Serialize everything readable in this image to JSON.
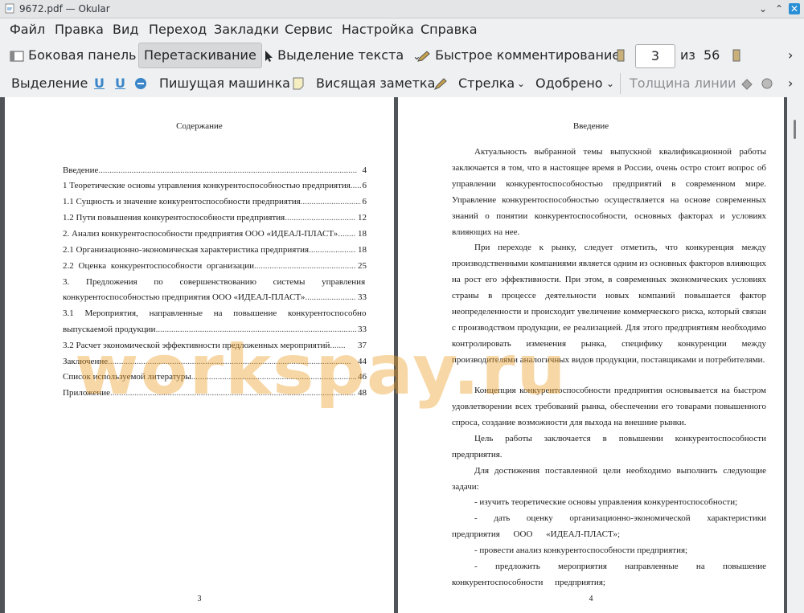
{
  "window": {
    "title": "9672.pdf  — Okular",
    "min": "⌄",
    "max": "⌃",
    "close": "✕"
  },
  "menu": [
    "Файл",
    "Правка",
    "Вид",
    "Переход",
    "Закладки",
    "Сервис",
    "Настройка",
    "Справка"
  ],
  "toolbar1": {
    "sidebar": "Боковая панель",
    "browse": "Перетаскивание",
    "text_select": "Выделение текста",
    "quick_annot": "Быстрое комментирование",
    "page_current": "3",
    "page_of": "из",
    "page_total": "56",
    "more": "›"
  },
  "toolbar2": {
    "highlight": "Выделение",
    "underline1": "U",
    "underline2": "U",
    "typewriter": "Пишущая машинка",
    "popup_note": "Висящая заметка",
    "arrow": "Стрелка",
    "stamp": "Одобрено",
    "line_width": "Толщина линии",
    "more": "›"
  },
  "page3": {
    "title": "Содержание",
    "toc": [
      {
        "text": "Введение",
        "page": "4"
      },
      {
        "text": "1 Теоретические основы управления конкурентоспособностью предприятия",
        "page": "6"
      },
      {
        "text": "1.1 Сущность и значение конкурентоспособности предприятия",
        "page": "6"
      },
      {
        "text": "1.2 Пути повышения конкурентоспособности предприятия",
        "page": "12"
      },
      {
        "text": "2. Анализ конкурентоспособности предприятия ООО «ИДЕАЛ-ПЛАСТ»",
        "page": "18"
      },
      {
        "text": "2.1 Организационно-экономическая характеристика предприятия",
        "page": "18"
      },
      {
        "text": "2.2 Оценка конкурентоспособности организации",
        "page": "25"
      },
      {
        "text": "3. Предложения по совершенствованию системы управления",
        "page": ""
      },
      {
        "text": "конкурентоспособностью предприятия ООО «ИДЕАЛ-ПЛАСТ»",
        "page": "33"
      },
      {
        "text": "3.1 Мероприятия, направленные на повышение конкурентоспособности",
        "page": ""
      },
      {
        "text": "выпускаемой продукции",
        "page": "33"
      },
      {
        "text": "3.2 Расчет экономической эффективности предложенных мероприятий",
        "page": "37"
      },
      {
        "text": "Заключение",
        "page": "44"
      },
      {
        "text": "Список используемой литературы",
        "page": "46"
      },
      {
        "text": "Приложение",
        "page": "48"
      }
    ],
    "footer": "3"
  },
  "page4": {
    "title": "Введение",
    "p1": "Актуальность выбранной темы выпускной квалификационной работы заключается в том, что в настоящее время в России, очень остро стоит вопрос об управлении конкурентоспособностью предприятий в современном мире. Управление конкурентоспособностью осуществляется на основе современных знаний о понятии конкурентоспособности, основных факторах и условиях влияющих на нее.",
    "p2": "При переходе к рынку, следует отметить, что конкуренция между производственными компаниями является одним из основных факторов влияющих на рост его эффективности. При этом, в современных экономических условиях страны в процессе деятельности новых компаний повышается фактор неопределенности и происходит увеличение коммерческого риска, который связан с производством продукции, ее реализацией. Для этого предприятиям необходимо контролировать изменения рынка, специфику конкуренции между производителями аналогичных видов продукции, поставщиками и потребителями.",
    "p3": "Концепция конкурентоспособности предприятия основывается на быстром удовлетворении всех требований рынка, обеспечении его товарами повышенного спроса, создание возможности для выхода на внешние рынки.",
    "p4": "Цель работы заключается в повышении конкурентоспособности предприятия.",
    "p5": "Для достижения поставленной цели необходимо выполнить следующие задачи:",
    "p6": "- изучить теоретические основы управления конкурентоспособности;",
    "p7": "- дать оценку организационно-экономической характеристики предприятия ООО «ИДЕАЛ-ПЛАСТ»;",
    "p8": "- провести анализ конкурентоспособности предприятия;",
    "p9": "- предложить мероприятия направленные на повышение конкурентоспособности предприятия;",
    "footer": "4"
  },
  "watermark": "workspay.ru"
}
